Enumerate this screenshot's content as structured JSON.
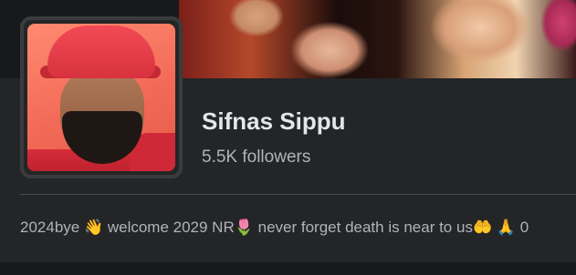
{
  "profile": {
    "name": "Sifnas Sippu",
    "followers": "5.5K followers",
    "bio": "2024bye 👋 welcome 2029 NR🌷 never forget death is near to us🤲 🙏 0"
  }
}
